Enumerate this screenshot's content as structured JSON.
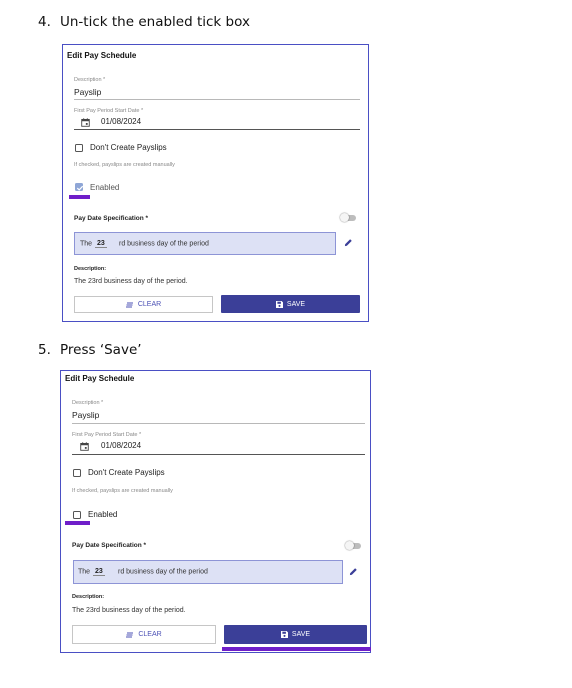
{
  "colors": {
    "accent": "#3b3f98",
    "highlight": "#6f1ec9",
    "panel_border": "#4a4fc4",
    "spec_fill": "#dde1f5"
  },
  "steps": [
    {
      "number": "4.",
      "text": "Un-tick the enabled tick box",
      "panel": {
        "title": "Edit Pay Schedule",
        "description_label": "Description *",
        "description_value": "Payslip",
        "start_label": "First Pay Period Start Date *",
        "start_value": "01/08/2024",
        "dont_create_label": "Don't Create Payslips",
        "dont_create_checked": false,
        "hint": "If checked, payslips are created manually",
        "enabled_label": "Enabled",
        "enabled_checked": true,
        "spec_label": "Pay Date Specification *",
        "spec_prefix": "The",
        "spec_day": "23",
        "spec_suffix": "rd  business day of the period",
        "desc_heading": "Description:",
        "desc_text": "The 23rd business day of the period.",
        "clear_label": "CLEAR",
        "save_label": "SAVE"
      }
    },
    {
      "number": "5.",
      "text": "Press ‘Save’",
      "panel": {
        "title": "Edit Pay Schedule",
        "description_label": "Description *",
        "description_value": "Payslip",
        "start_label": "First Pay Period Start Date *",
        "start_value": "01/08/2024",
        "dont_create_label": "Don't Create Payslips",
        "dont_create_checked": false,
        "hint": "If checked, payslips are created manually",
        "enabled_label": "Enabled",
        "enabled_checked": false,
        "spec_label": "Pay Date Specification *",
        "spec_prefix": "The",
        "spec_day": "23",
        "spec_suffix": "rd  business day of the period",
        "desc_heading": "Description:",
        "desc_text": "The 23rd business day of the period.",
        "clear_label": "CLEAR",
        "save_label": "SAVE"
      }
    }
  ]
}
